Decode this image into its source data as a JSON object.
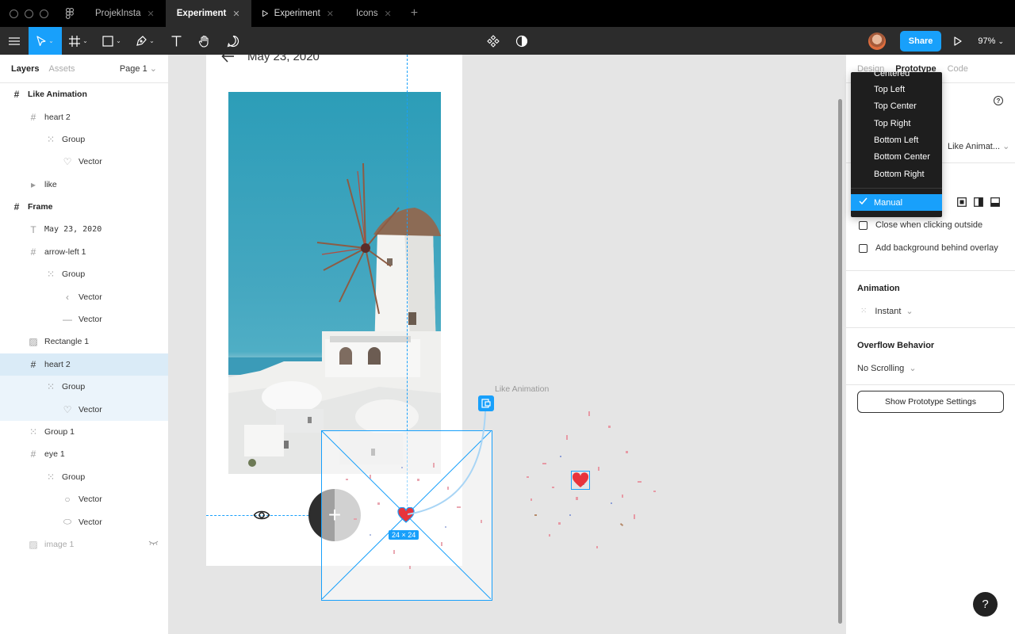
{
  "tabs": [
    {
      "label": "ProjekInsta"
    },
    {
      "label": "Experiment"
    },
    {
      "label": "Experiment"
    },
    {
      "label": "Icons"
    }
  ],
  "toolbar": {
    "share_label": "Share",
    "zoom": "97%"
  },
  "left_panel": {
    "layers_tab": "Layers",
    "assets_tab": "Assets",
    "page_label": "Page 1",
    "layers": [
      {
        "label": "Like Animation"
      },
      {
        "label": "heart 2"
      },
      {
        "label": "Group"
      },
      {
        "label": "Vector"
      },
      {
        "label": "like"
      },
      {
        "label": "Frame"
      },
      {
        "label": "May 23, 2020"
      },
      {
        "label": "arrow-left 1"
      },
      {
        "label": "Group"
      },
      {
        "label": "Vector"
      },
      {
        "label": "Vector"
      },
      {
        "label": "Rectangle 1"
      },
      {
        "label": "heart 2"
      },
      {
        "label": "Group"
      },
      {
        "label": "Vector"
      },
      {
        "label": "Group 1"
      },
      {
        "label": "eye 1"
      },
      {
        "label": "Group"
      },
      {
        "label": "Vector"
      },
      {
        "label": "Vector"
      },
      {
        "label": "image 1"
      }
    ]
  },
  "canvas": {
    "frame_title": "May 23, 2020",
    "frame_label": "Like Animation",
    "size_badge": "24 × 24",
    "accent": "#18a0fb",
    "heart_color": "#e8343c"
  },
  "right_panel": {
    "tabs": [
      "Design",
      "Prototype",
      "Code"
    ],
    "destination": "Like Animat...",
    "close_outside": "Close when clicking outside",
    "add_background": "Add background behind overlay",
    "animation_heading": "Animation",
    "animation_value": "Instant",
    "overflow_heading": "Overflow Behavior",
    "overflow_value": "No Scrolling",
    "show_settings": "Show Prototype Settings"
  },
  "dropdown": {
    "options": [
      "Centered",
      "Top Left",
      "Top Center",
      "Top Right",
      "Bottom Left",
      "Bottom Center",
      "Bottom Right",
      "Manual"
    ],
    "selected": "Manual"
  },
  "help_label": "?"
}
